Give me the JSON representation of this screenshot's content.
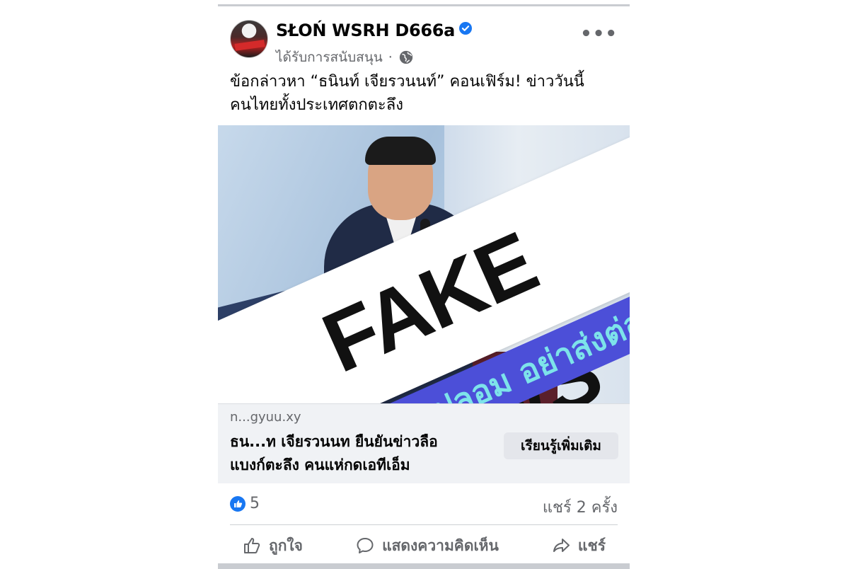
{
  "post": {
    "author": "SŁOŃ WSRH D666a",
    "sponsored_label": "ได้รับการสนับสนุน",
    "separator": "·",
    "more_label": "•••",
    "text_line1": "ข้อกล่าวหา “ธนินท์ เจียรวนนท์” คอนเฟิร์ม! ข่าววันนี้",
    "text_line2": "คนไทยทั้งประเทศตกตะลึง"
  },
  "image": {
    "overlay_text": "FAKE NEWS",
    "overlay_subtext": "ข่าวปลอม อย่าส่งต่อ"
  },
  "link": {
    "domain": "n...gyuu.xy",
    "title_line1": "ธน...ท เจียรวนนท ยืนยันข่าวลือ",
    "title_line2": "แบงก์ตะลึง คนแห่กดเอทีเอ็ม",
    "cta_label": "เรียนรู้เพิ่มเติม"
  },
  "stats": {
    "like_count": "5",
    "share_count": "แชร์ 2 ครั้ง"
  },
  "actions": {
    "like_label": "ถูกใจ",
    "comment_label": "แสดงความคิดเห็น",
    "share_label": "แชร์"
  },
  "colors": {
    "accent": "#1877f2",
    "banner_blue": "#4c4fd8",
    "banner_text": "#7de3ea"
  }
}
